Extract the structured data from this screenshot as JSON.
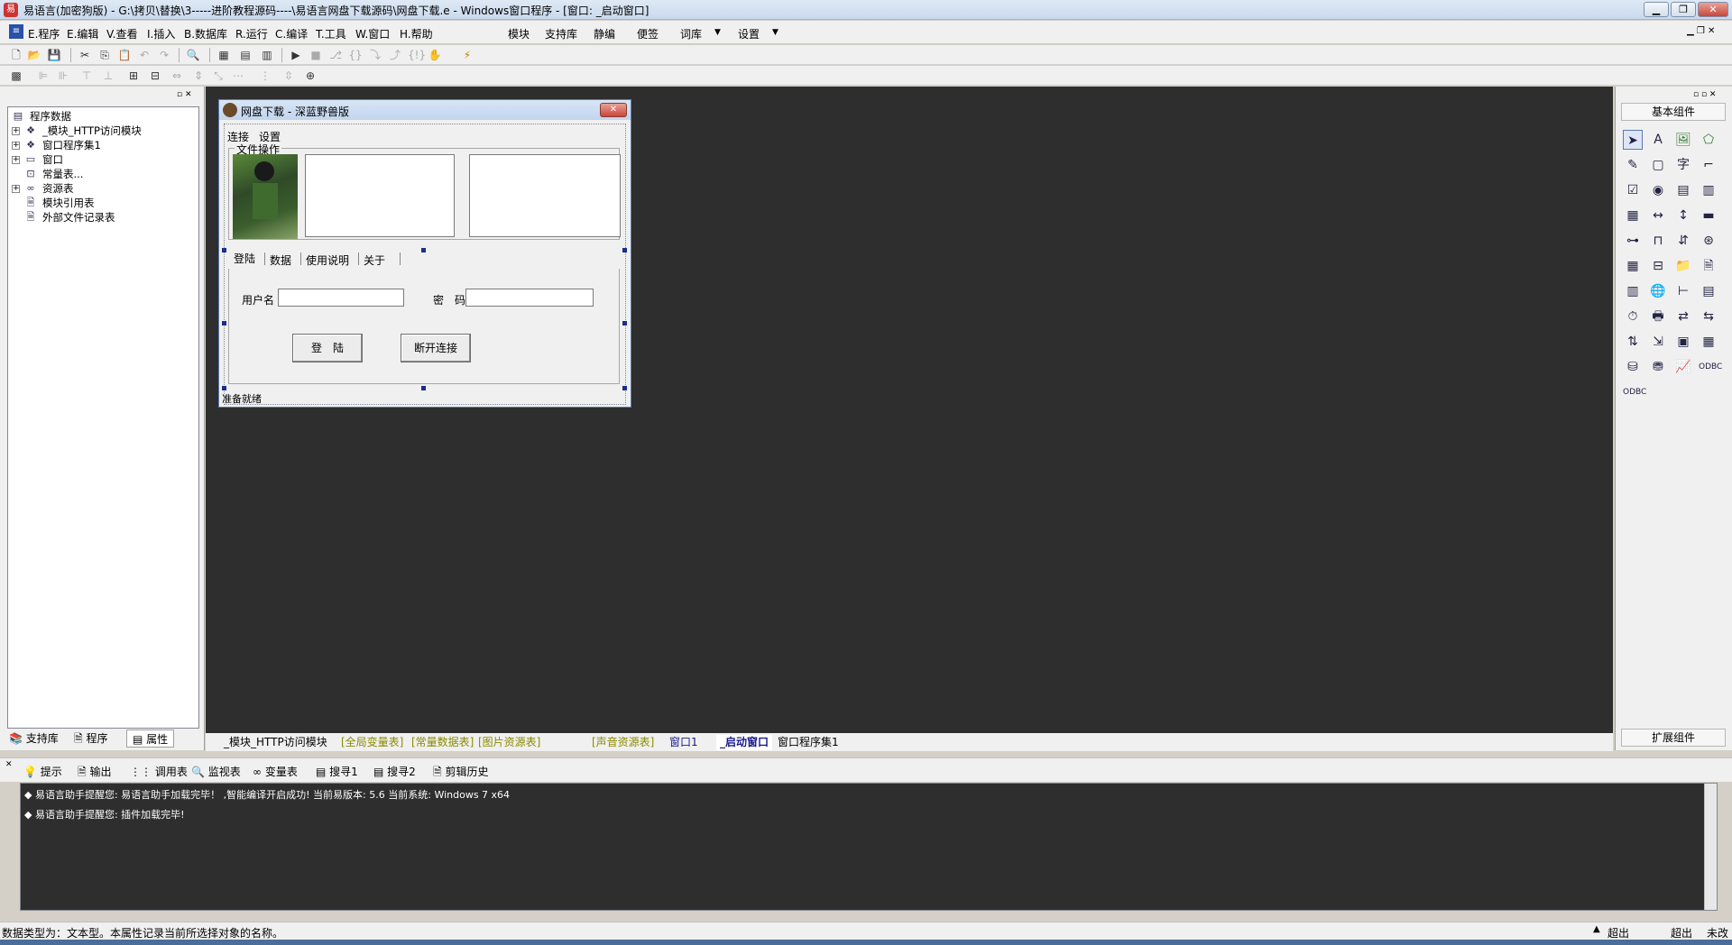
{
  "window": {
    "title": "易语言(加密狗版) - G:\\拷贝\\替换\\3-----进阶教程源码----\\易语言网盘下载源码\\网盘下载.e - Windows窗口程序 - [窗口: _启动窗口]",
    "app_icon": "易"
  },
  "menu": {
    "items": [
      "E.程序",
      "E.编辑",
      "V.查看",
      "I.插入",
      "B.数据库",
      "R.运行",
      "C.编译",
      "T.工具",
      "W.窗口",
      "H.帮助"
    ],
    "extra": [
      "模块",
      "支持库",
      "静编",
      "便签",
      "词库",
      "设置"
    ]
  },
  "left_panel": {
    "tree": [
      {
        "label": "程序数据",
        "icon": "folder-icon"
      },
      {
        "label": "_模块_HTTP访问模块",
        "icon": "module-icon"
      },
      {
        "label": "窗口程序集1",
        "icon": "module-icon"
      },
      {
        "label": "窗口",
        "icon": "window-icon"
      },
      {
        "label": "常量表...",
        "icon": "constant-icon"
      },
      {
        "label": "资源表",
        "icon": "resource-icon"
      },
      {
        "label": "模块引用表",
        "icon": "doc-icon"
      },
      {
        "label": "外部文件记录表",
        "icon": "doc-icon"
      }
    ],
    "tabs": [
      "支持库",
      "程序",
      "属性"
    ]
  },
  "form": {
    "title": "网盘下载 - 深蓝野兽版",
    "menu": [
      "连接",
      "设置"
    ],
    "group_label": "文件操作",
    "tabs": [
      "登陆",
      "数据",
      "使用说明",
      "关于"
    ],
    "username_label": "用户名",
    "password_label": "密　码",
    "login_button": "登　陆",
    "disconnect_button": "断开连接",
    "status": "准备就绪"
  },
  "right_panel": {
    "header": "基本组件",
    "footer": "扩展组件"
  },
  "bottom_tabs": [
    "_模块_HTTP访问模块",
    "[全局变量表]",
    "[常量数据表]",
    "[图片资源表]",
    "[声音资源表]",
    "窗口1",
    "_启动窗口",
    "窗口程序集1"
  ],
  "output": {
    "tabs": [
      "提示",
      "输出",
      "调用表",
      "监视表",
      "变量表",
      "搜寻1",
      "搜寻2",
      "剪辑历史"
    ],
    "lines": [
      "◆ 易语言助手提醒您: 易语言助手加载完毕！  ,智能编译开启成功!  当前易版本: 5.6  当前系统: Windows 7 x64",
      "◆ 易语言助手提醒您: 插件加载完毕!"
    ]
  },
  "status": {
    "text": "数据类型为：文本型。本属性记录当前所选择对象的名称。",
    "right": [
      "超出",
      "超出",
      "未改"
    ]
  }
}
